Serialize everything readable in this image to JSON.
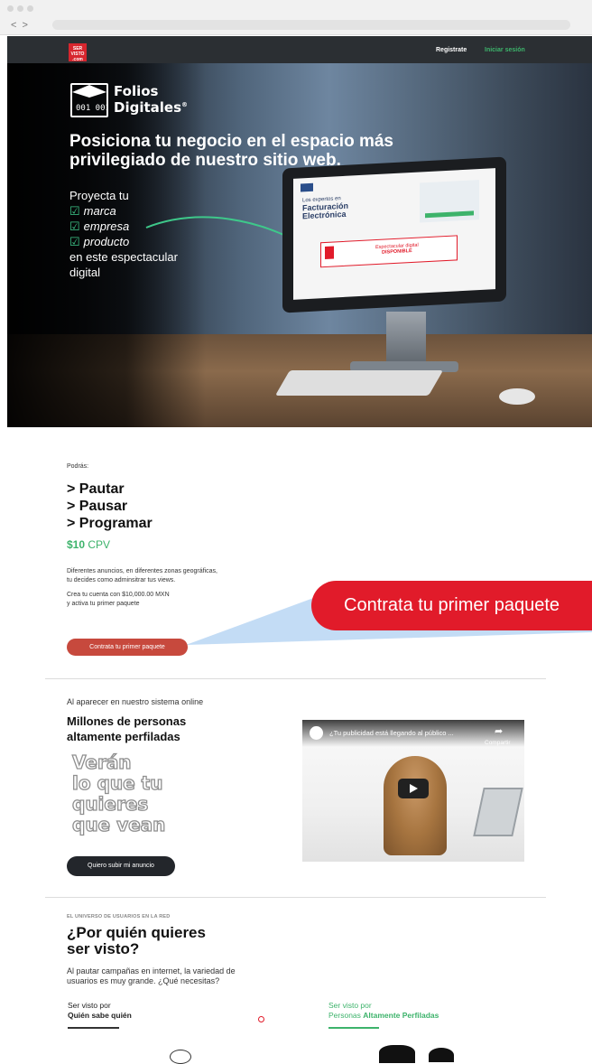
{
  "nav": {
    "logo_text": "SER\nVISTO\n.com",
    "register": "Registrate",
    "login": "Iniciar sesión",
    "login_color": "#3db36b"
  },
  "hero": {
    "brand_line1": "Folios",
    "brand_line2": "Digitales",
    "brand_mark": "®",
    "headline": "Posiciona tu negocio en el espacio más privilegiado de nuestro sitio web.",
    "proyecta": "Proyecta tu",
    "items": [
      "marca",
      "empresa",
      "producto"
    ],
    "closing": "en este espectacular digital",
    "screen_title1": "Los expertos en",
    "screen_title2": "Facturación",
    "screen_title3": "Electrónica",
    "screen_banner_line1": "Espectacular digital",
    "screen_banner_line2": "DISPONIBLE",
    "accent_color": "#3ec88a"
  },
  "offer": {
    "podras": "Podrás:",
    "actions": [
      "> Pautar",
      "> Pausar",
      "> Programar"
    ],
    "price_amount": "$10",
    "price_unit": "CPV",
    "desc1_line1": "Diferentes anuncios, en diferentes zonas geográficas,",
    "desc1_line2": "tu decides como adminsitrar tus views.",
    "desc2_line1": "Crea tu cuenta con $10,000.00 MXN",
    "desc2_line2": "y activa tu primer paquete",
    "button": "Contrata tu primer paquete",
    "callout": "Contrata tu primer paquete",
    "button_color": "#c7493d",
    "callout_color": "#e11b2a"
  },
  "audience": {
    "intro": "Al aparecer en nuestro sistema online",
    "heading_line1": "Millones de personas",
    "heading_line2": "altamente perfiladas",
    "slogan": [
      "Verán",
      "lo que tu",
      "quieres",
      "que vean"
    ],
    "button": "Quiero subir mi anuncio",
    "video_title": "¿Tu publicidad está llegando al público ...",
    "video_share": "Compartir"
  },
  "universe": {
    "eyebrow": "EL UNIVERSO DE USUARIOS EN LA RED",
    "heading_line1": "¿Por quién quieres",
    "heading_line2": "ser visto?",
    "body_line1": "Al pautar campañas en internet, la variedad de",
    "body_line2": "usuarios es muy grande. ¿Qué necesitas?",
    "option1_small": "Ser visto por",
    "option1_big": "Quién sabe quién",
    "option2_small": "Ser visto por",
    "option2_big_a": "Personas ",
    "option2_big_b": "Altamente Perfiladas",
    "option2_color": "#3db36b"
  }
}
